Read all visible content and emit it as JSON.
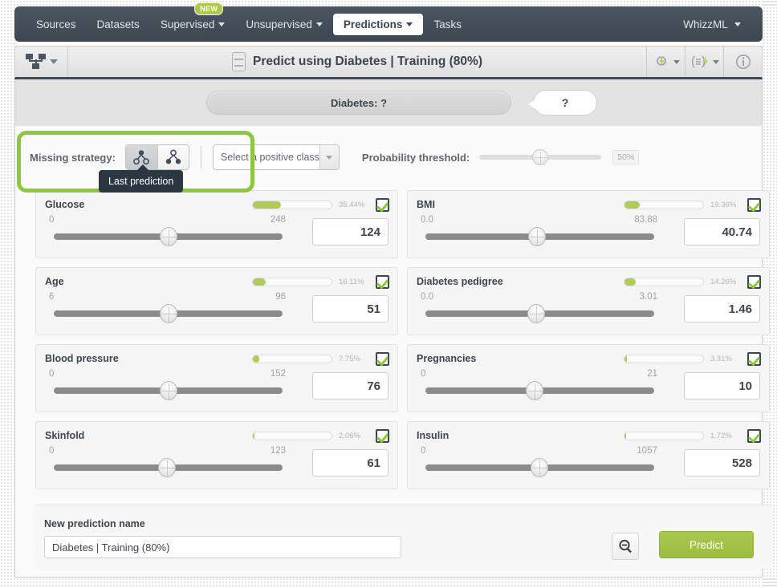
{
  "colors": {
    "accent_green": "#8dc63f",
    "bar_green": "#aecd57",
    "nav_dark": "#3d4852",
    "tooltip_dark": "#2c3742"
  },
  "nav": {
    "items": [
      {
        "label": "Sources",
        "caret": false,
        "active": false,
        "badge": ""
      },
      {
        "label": "Datasets",
        "caret": false,
        "active": false,
        "badge": ""
      },
      {
        "label": "Supervised",
        "caret": true,
        "active": false,
        "badge": "NEW"
      },
      {
        "label": "Unsupervised",
        "caret": true,
        "active": false,
        "badge": ""
      },
      {
        "label": "Predictions",
        "caret": true,
        "active": true,
        "badge": ""
      },
      {
        "label": "Tasks",
        "caret": false,
        "active": false,
        "badge": ""
      }
    ],
    "account": {
      "label": "WhizzML",
      "caret": true
    }
  },
  "subheader": {
    "model_icon": "model-tree-icon",
    "slider_icon": "prediction-slider-icon",
    "title": "Predict using Diabetes | Training (80%)",
    "actions": [
      {
        "icon": "lightning-cloud-icon",
        "caret": true
      },
      {
        "icon": "batch-prediction-icon",
        "caret": true
      },
      {
        "icon": "info-icon",
        "caret": false
      }
    ]
  },
  "prediction_strip": {
    "objective_text": "Diabetes: ?",
    "confidence_text": "?"
  },
  "options": {
    "missing_strategy_label": "Missing strategy:",
    "strategies": [
      {
        "name": "last-prediction",
        "icon": "tree-last-prediction-icon",
        "selected": true
      },
      {
        "name": "proportional",
        "icon": "tree-proportional-icon",
        "selected": false
      }
    ],
    "tooltip": "Last prediction",
    "positive_class": {
      "value": "Select a positive class",
      "placeholder": "Select a positive class"
    },
    "threshold_label": "Probability threshold:",
    "threshold_value": "50%",
    "threshold_percent": 50
  },
  "fields": [
    {
      "name": "Glucose",
      "importance_text": "35.44%",
      "importance_percent": 35.44,
      "min": "0",
      "max": "248",
      "value": "124",
      "knob_percent": 50,
      "checked": true
    },
    {
      "name": "BMI",
      "importance_text": "19.36%",
      "importance_percent": 19.36,
      "min": "0.0",
      "max": "83.88",
      "value": "40.74",
      "knob_percent": 48.6,
      "checked": true
    },
    {
      "name": "Age",
      "importance_text": "16.11%",
      "importance_percent": 16.11,
      "min": "6",
      "max": "96",
      "value": "51",
      "knob_percent": 50,
      "checked": true
    },
    {
      "name": "Diabetes pedigree",
      "importance_text": "14.26%",
      "importance_percent": 14.26,
      "min": "0.0",
      "max": "3.01",
      "value": "1.46",
      "knob_percent": 48.5,
      "checked": true
    },
    {
      "name": "Blood pressure",
      "importance_text": "7.75%",
      "importance_percent": 7.75,
      "min": "0",
      "max": "152",
      "value": "76",
      "knob_percent": 50,
      "checked": true
    },
    {
      "name": "Pregnancies",
      "importance_text": "3.31%",
      "importance_percent": 3.31,
      "min": "0",
      "max": "21",
      "value": "10",
      "knob_percent": 47.6,
      "checked": true
    },
    {
      "name": "Skinfold",
      "importance_text": "2.06%",
      "importance_percent": 2.06,
      "min": "0",
      "max": "123",
      "value": "61",
      "knob_percent": 49.6,
      "checked": true
    },
    {
      "name": "Insulin",
      "importance_text": "1.72%",
      "importance_percent": 1.72,
      "min": "0",
      "max": "1057",
      "value": "528",
      "knob_percent": 49.9,
      "checked": true
    }
  ],
  "footer": {
    "new_prediction_label": "New prediction name",
    "new_prediction_value": "Diabetes | Training (80%)",
    "new_prediction_placeholder": "New prediction name",
    "zoom_icon": "magnifier-minus-icon",
    "predict_label": "Predict"
  }
}
